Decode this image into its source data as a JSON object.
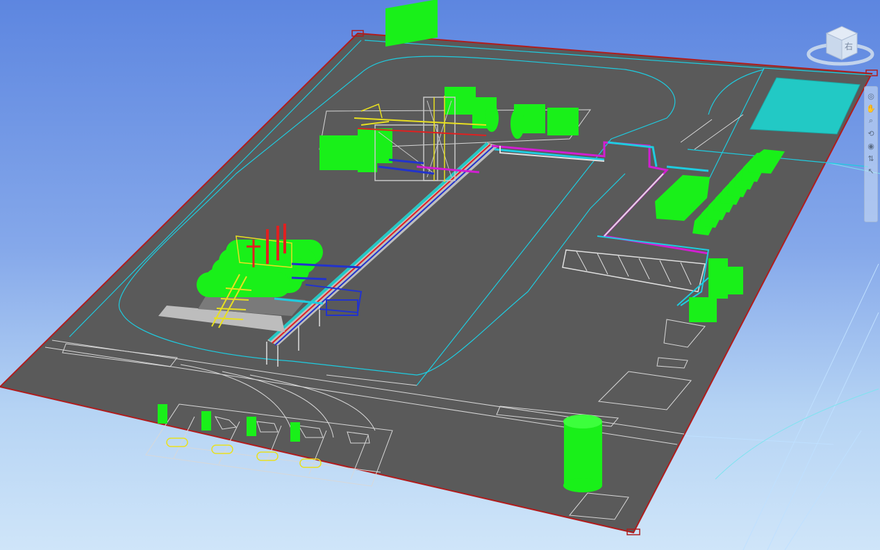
{
  "viewcube": {
    "face_label": "右"
  },
  "navigation_bar": {
    "tools": [
      {
        "name": "steering-wheel-icon",
        "glyph": "◎"
      },
      {
        "name": "pan-icon",
        "glyph": "✋"
      },
      {
        "name": "zoom-icon",
        "glyph": "⌕"
      },
      {
        "name": "orbit-icon",
        "glyph": "⟲"
      },
      {
        "name": "look-icon",
        "glyph": "◉"
      },
      {
        "name": "walk-icon",
        "glyph": "⇅"
      },
      {
        "name": "select-icon",
        "glyph": "↖"
      }
    ]
  },
  "colors": {
    "site_fill": "#5a5a5a",
    "site_boundary": "#b01c1c",
    "equipment": "#19f019",
    "road_line": "#1ecce0",
    "pad_fill": "#22c9c5",
    "pipe_blue": "#2233cc",
    "pipe_magenta": "#d21ed2",
    "pipe_red": "#e02020",
    "pipe_yellow": "#e8e020"
  }
}
